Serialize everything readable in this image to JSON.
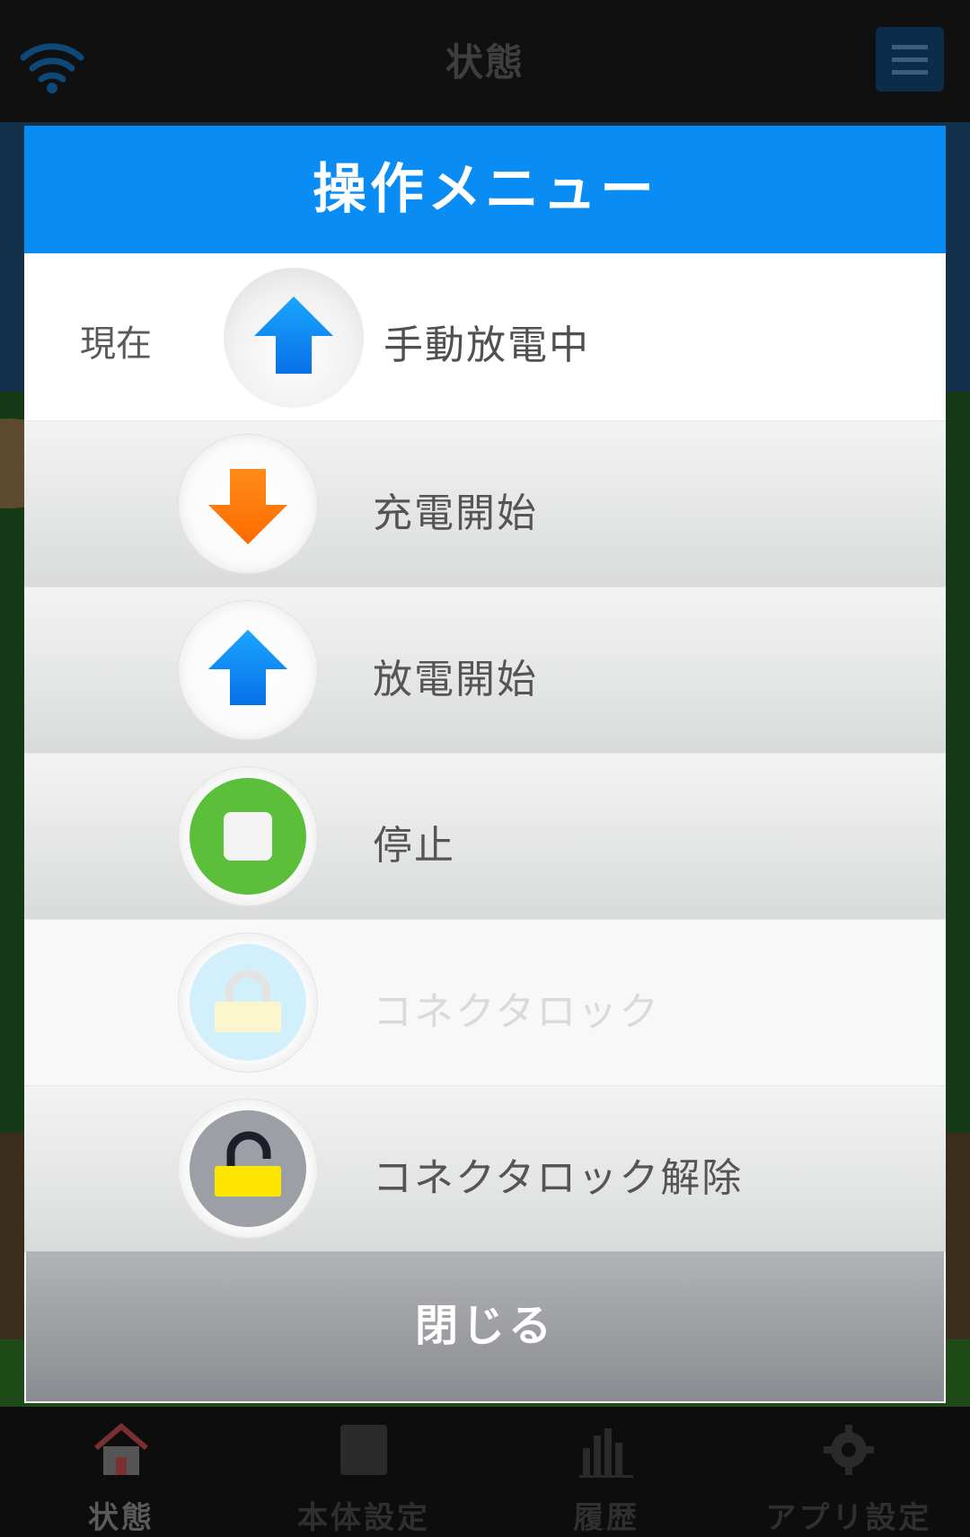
{
  "app": {
    "title": "状態",
    "icons": {
      "wifi": "wifi-icon",
      "menu": "hamburger-menu-icon"
    }
  },
  "bottom_nav": {
    "items": [
      {
        "label": "状態",
        "icon": "home-icon",
        "active": true
      },
      {
        "label": "本体設定",
        "icon": "device-icon",
        "active": false
      },
      {
        "label": "履歴",
        "icon": "bar-chart-icon",
        "active": false
      },
      {
        "label": "アプリ設定",
        "icon": "gear-icon",
        "active": false
      }
    ]
  },
  "dialog": {
    "title": "操作メニュー",
    "current": {
      "label": "現在",
      "status": "手動放電中",
      "icon": "discharge-up-arrow-icon"
    },
    "operations": [
      {
        "label": "充電開始",
        "icon": "charge-down-arrow-icon",
        "enabled": true
      },
      {
        "label": "放電開始",
        "icon": "discharge-up-arrow-icon",
        "enabled": true
      },
      {
        "label": "停止",
        "icon": "stop-icon",
        "enabled": true
      },
      {
        "label": "コネクタロック",
        "icon": "lock-icon",
        "enabled": false
      },
      {
        "label": "コネクタロック解除",
        "icon": "unlock-icon",
        "enabled": true
      }
    ],
    "close_label": "閉じる"
  },
  "colors": {
    "header_blue": "#0a8cf5",
    "charge_orange": "#ff7a00",
    "discharge_blue": "#0a84f0",
    "stop_green": "#5cbf3c",
    "lock_yellow": "#ffe600"
  }
}
